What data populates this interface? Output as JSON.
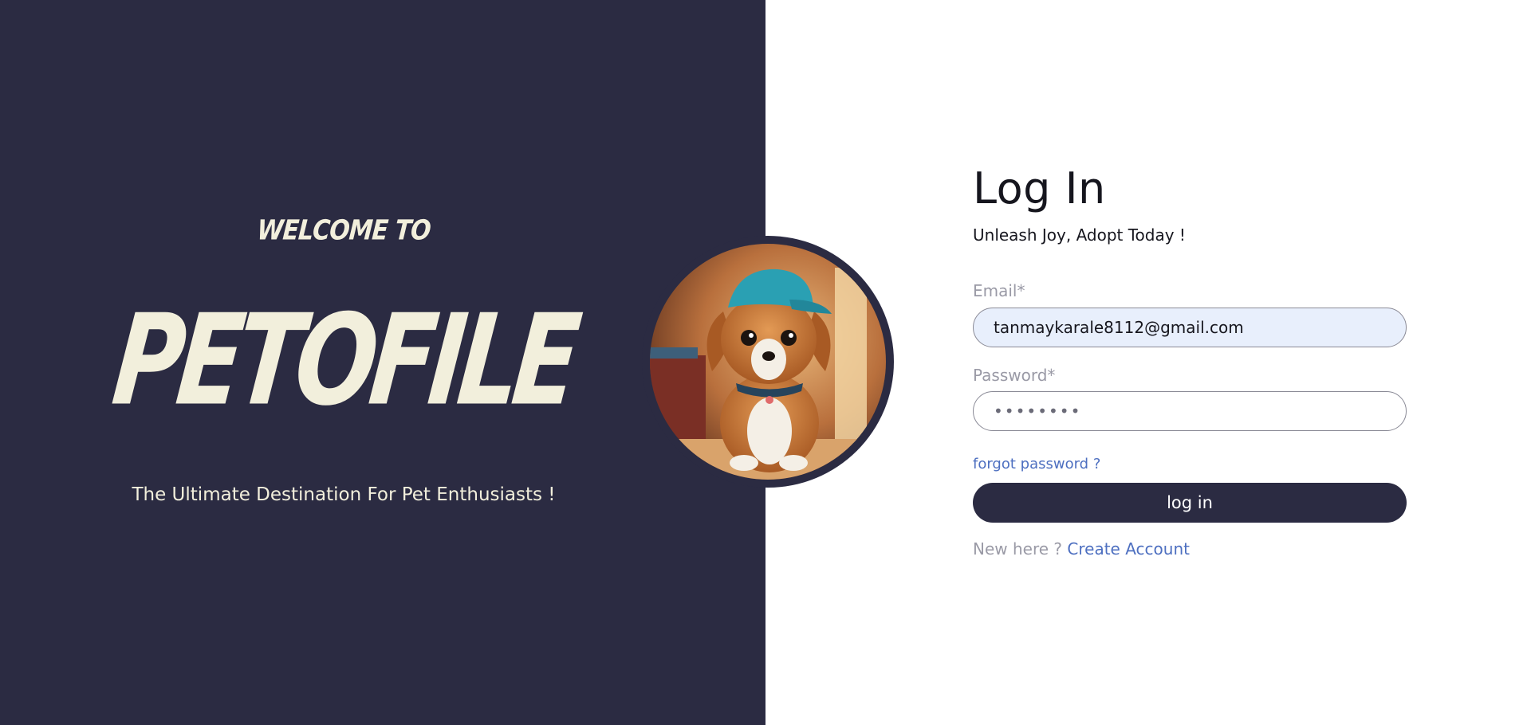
{
  "left": {
    "welcome": "WELCOME TO",
    "brand": "PETOFILE",
    "tagline": "The Ultimate Destination For Pet Enthusiasts !"
  },
  "login": {
    "title": "Log In",
    "subtitle": "Unleash Joy, Adopt Today !",
    "email_label": "Email*",
    "email_value": "tanmaykarale8112@gmail.com",
    "password_label": "Password*",
    "password_value": "••••••••",
    "forgot_label": "forgot password ?",
    "button_label": "log in",
    "new_here": "New here ?",
    "create_account": "Create Account"
  },
  "colors": {
    "panel": "#2b2b42",
    "cream": "#f2efdc",
    "link": "#4d6fc0",
    "muted": "#9a9aa6"
  }
}
